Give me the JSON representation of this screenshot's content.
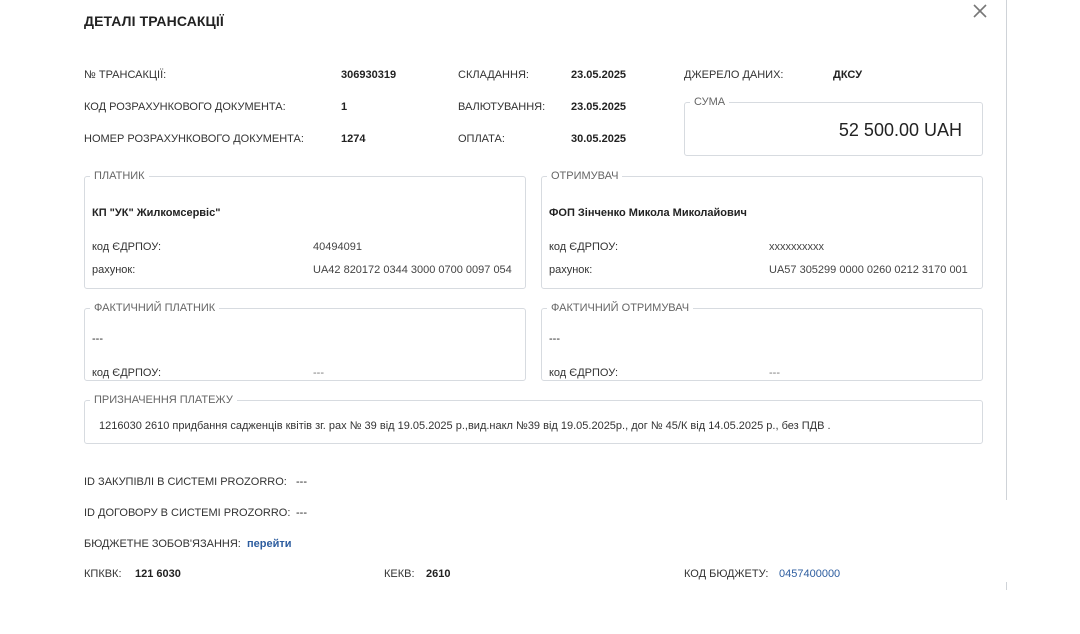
{
  "modal": {
    "title": "ДЕТАЛІ ТРАНСАКЦІЇ",
    "close_icon": "close-icon"
  },
  "transaction": {
    "number_label": "№ ТРАНСАКЦІЇ:",
    "number_value": "306930319",
    "doc_code_label": "КОД РОЗРАХУНКОВОГО ДОКУМЕНТА:",
    "doc_code_value": "1",
    "doc_number_label": "НОМЕР РОЗРАХУНКОВОГО ДОКУМЕНТА:",
    "doc_number_value": "1274",
    "compiled_label": "СКЛАДАННЯ:",
    "compiled_value": "23.05.2025",
    "valuation_label": "ВАЛЮТУВАННЯ:",
    "valuation_value": "23.05.2025",
    "payment_label": "ОПЛАТА:",
    "payment_value": "30.05.2025",
    "source_label": "ДЖЕРЕЛО ДАНИХ:",
    "source_value": "ДКСУ"
  },
  "sum": {
    "legend": "СУМА",
    "value": "52 500.00 UAH"
  },
  "payer": {
    "legend": "ПЛАТНИК",
    "name": "КП \"УК\" Жилкомсервіс\"",
    "edrpou_label": "код ЄДРПОУ:",
    "edrpou_value": "40494091",
    "account_label": "рахунок:",
    "account_value": "UA42 820172 0344 3000 0700 0097 054"
  },
  "receiver": {
    "legend": "ОТРИМУВАЧ",
    "name": "ФОП Зінченко Микола Миколайович",
    "edrpou_label": "код ЄДРПОУ:",
    "edrpou_value": "xxxxxxxxxx",
    "account_label": "рахунок:",
    "account_value": "UA57 305299 0000 0260 0212 3170 001"
  },
  "actual_payer": {
    "legend": "ФАКТИЧНИЙ ПЛАТНИК",
    "name": "---",
    "edrpou_label": "код ЄДРПОУ:",
    "edrpou_value": "---"
  },
  "actual_receiver": {
    "legend": "ФАКТИЧНИЙ ОТРИМУВАЧ",
    "name": "---",
    "edrpou_label": "код ЄДРПОУ:",
    "edrpou_value": "---"
  },
  "purpose": {
    "legend": "ПРИЗНАЧЕННЯ ПЛАТЕЖУ",
    "text": "1216030 2610 придбання саджeнців квітів зг. рах № 39 від 19.05.2025 р.,вид.накл №39 від 19.05.2025р., дог № 45/К від 14.05.2025 р., без ПДВ ."
  },
  "footer": {
    "procurement_label": "ID ЗАКУПІВЛІ В СИСТЕМІ PROZORRO:",
    "procurement_value": "---",
    "contract_label": "ID ДОГОВОРУ В СИСТЕМІ PROZORRO:",
    "contract_value": "---",
    "budget_obligation_label": "БЮДЖЕТНЕ ЗОБОВ'ЯЗАННЯ:",
    "budget_obligation_link": "перейти",
    "kpkvk_label": "КПКВК:",
    "kpkvk_value": "121 6030",
    "kekv_label": "КЕКВ:",
    "kekv_value": "2610",
    "budget_code_label": "КОД БЮДЖЕТУ:",
    "budget_code_value": "0457400000"
  },
  "colors": {
    "link": "#2d5d9f",
    "border": "#d7dbe0"
  }
}
